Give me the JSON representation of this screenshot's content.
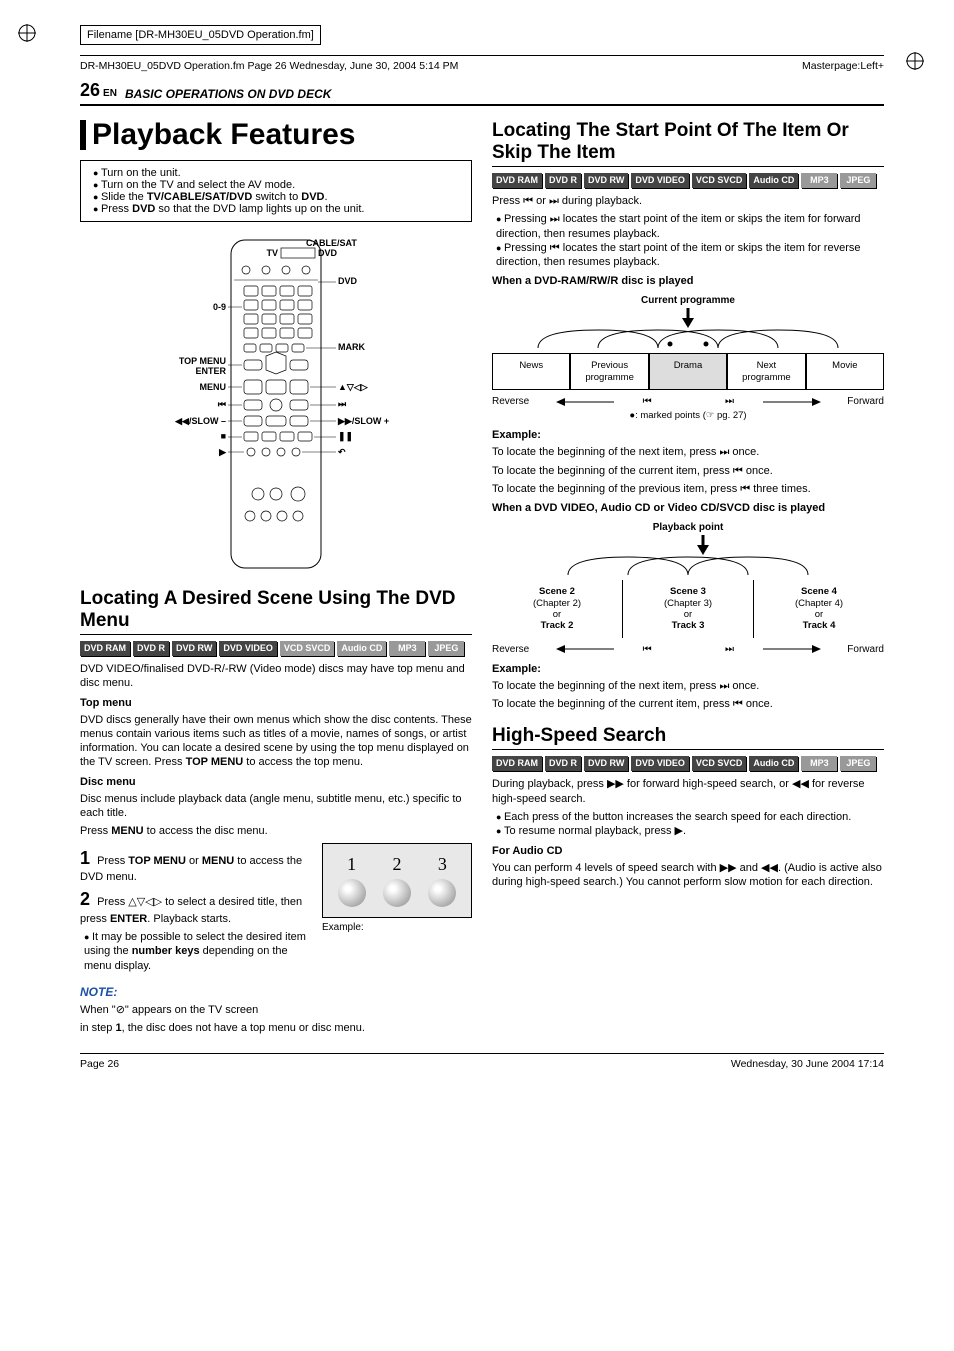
{
  "filename_label": "Filename [DR-MH30EU_05DVD Operation.fm]",
  "header_left": "DR-MH30EU_05DVD Operation.fm  Page 26  Wednesday, June 30, 2004  5:14 PM",
  "header_right": "Masterpage:Left+",
  "page_number": "26",
  "page_lang": "EN",
  "section_path": "BASIC OPERATIONS ON DVD DECK",
  "main_title": "Playback Features",
  "intro_bullets": [
    "Turn on the unit.",
    "Turn on the TV and select the AV mode.",
    "Slide the TV/CABLE/SAT/DVD switch to DVD.",
    "Press DVD so that the DVD lamp lights up on the unit."
  ],
  "remote_labels": {
    "top_right": "CABLE/SAT",
    "tv_dvd_left": "TV",
    "tv_dvd_right": "DVD",
    "r1": "DVD",
    "l1": "0-9",
    "r2": "MARK",
    "l2a": "TOP MENU",
    "l2b": "ENTER",
    "l3": "MENU",
    "r3": "▲▽◁▷",
    "l4": "⏮",
    "r4": "⏭",
    "l5": "◀◀/SLOW –",
    "r5": "▶▶/SLOW +",
    "l6": "■",
    "r6": "❚❚",
    "l7": "▶",
    "r7": "↶"
  },
  "sub1_title": "Locating A Desired Scene Using The DVD Menu",
  "badges_all": [
    "DVD RAM",
    "DVD R",
    "DVD RW",
    "DVD VIDEO",
    "VCD SVCD",
    "Audio CD",
    "MP3",
    "JPEG"
  ],
  "sub1_p1": "DVD VIDEO/finalised DVD-R/-RW (Video mode) discs may have top menu and disc menu.",
  "sub1_h1": "Top menu",
  "sub1_p2": "DVD discs generally have their own menus which show the disc contents. These menus contain various items such as titles of a movie, names of songs, or artist information. You can locate a desired scene by using the top menu displayed on the TV screen. Press TOP MENU to access the top menu.",
  "sub1_h2": "Disc menu",
  "sub1_p3": "Disc menus include playback data (angle menu, subtitle menu, etc.) specific to each title.",
  "sub1_p3b": "Press MENU to access the disc menu.",
  "step1_no": "1",
  "step1_text": "Press TOP MENU or MENU to access the DVD menu.",
  "step2_no": "2",
  "step2_text": "Press △▽◁▷ to select a desired title, then press ENTER. Playback starts.",
  "step2_bullet": "It may be possible to select the desired item using the number keys depending on the menu display.",
  "example_label": "Example:",
  "note_label": "NOTE:",
  "note_line1": "When \"⊘\" appears on the TV screen",
  "note_line2": "in step 1, the disc does not have a top menu or disc menu.",
  "sub2_title": "Locating The Start Point Of The Item Or Skip The Item",
  "sub2_p1": "Press ⏮ or ⏭ during playback.",
  "sub2_b1": "Pressing ⏭ locates the start point of the item or skips the item for forward direction, then resumes playback.",
  "sub2_b2": "Pressing ⏮ locates the start point of the item or skips the item for reverse direction, then resumes playback.",
  "sub2_h1": "When a DVD-RAM/RW/R disc is played",
  "diag1_label": "Current programme",
  "prog_cells1": [
    "News",
    "Previous programme",
    "Drama",
    "Next programme",
    "Movie"
  ],
  "reverse_label": "Reverse",
  "forward_label": "Forward",
  "marked_note": "●: marked points (☞ pg. 27)",
  "example_heading": "Example:",
  "ex1_l1": "To locate the beginning of the next item, press ⏭ once.",
  "ex1_l2": "To locate the beginning of the current item, press ⏮ once.",
  "ex1_l3": "To locate the beginning of the previous item, press ⏮ three times.",
  "sub2_h2": "When a DVD VIDEO, Audio CD or Video CD/SVCD disc is played",
  "diag2_label": "Playback point",
  "prog_cells2_a": [
    "Scene 2",
    "Scene 3",
    "Scene 4"
  ],
  "prog_cells2_b": [
    "(Chapter 2)",
    "(Chapter 3)",
    "(Chapter 4)"
  ],
  "prog_cells2_c": [
    "or",
    "or",
    "or"
  ],
  "prog_cells2_d": [
    "Track 2",
    "Track 3",
    "Track 4"
  ],
  "ex2_l1": "To locate the beginning of the next item, press ⏭ once.",
  "ex2_l2": "To locate the beginning of the current item, press ⏮ once.",
  "sub3_title": "High-Speed Search",
  "sub3_p1": "During playback, press ▶▶ for forward high-speed search, or ◀◀ for reverse high-speed search.",
  "sub3_b1": "Each press of the button increases the search speed for each direction.",
  "sub3_b2": "To resume normal playback, press ▶.",
  "sub3_h1": "For Audio CD",
  "sub3_p2": "You can perform 4 levels of speed search with ▶▶ and ◀◀. (Audio is active also during high-speed search.) You cannot perform slow motion for each direction.",
  "footer_left": "Page 26",
  "footer_right": "Wednesday, 30 June 2004  17:14"
}
